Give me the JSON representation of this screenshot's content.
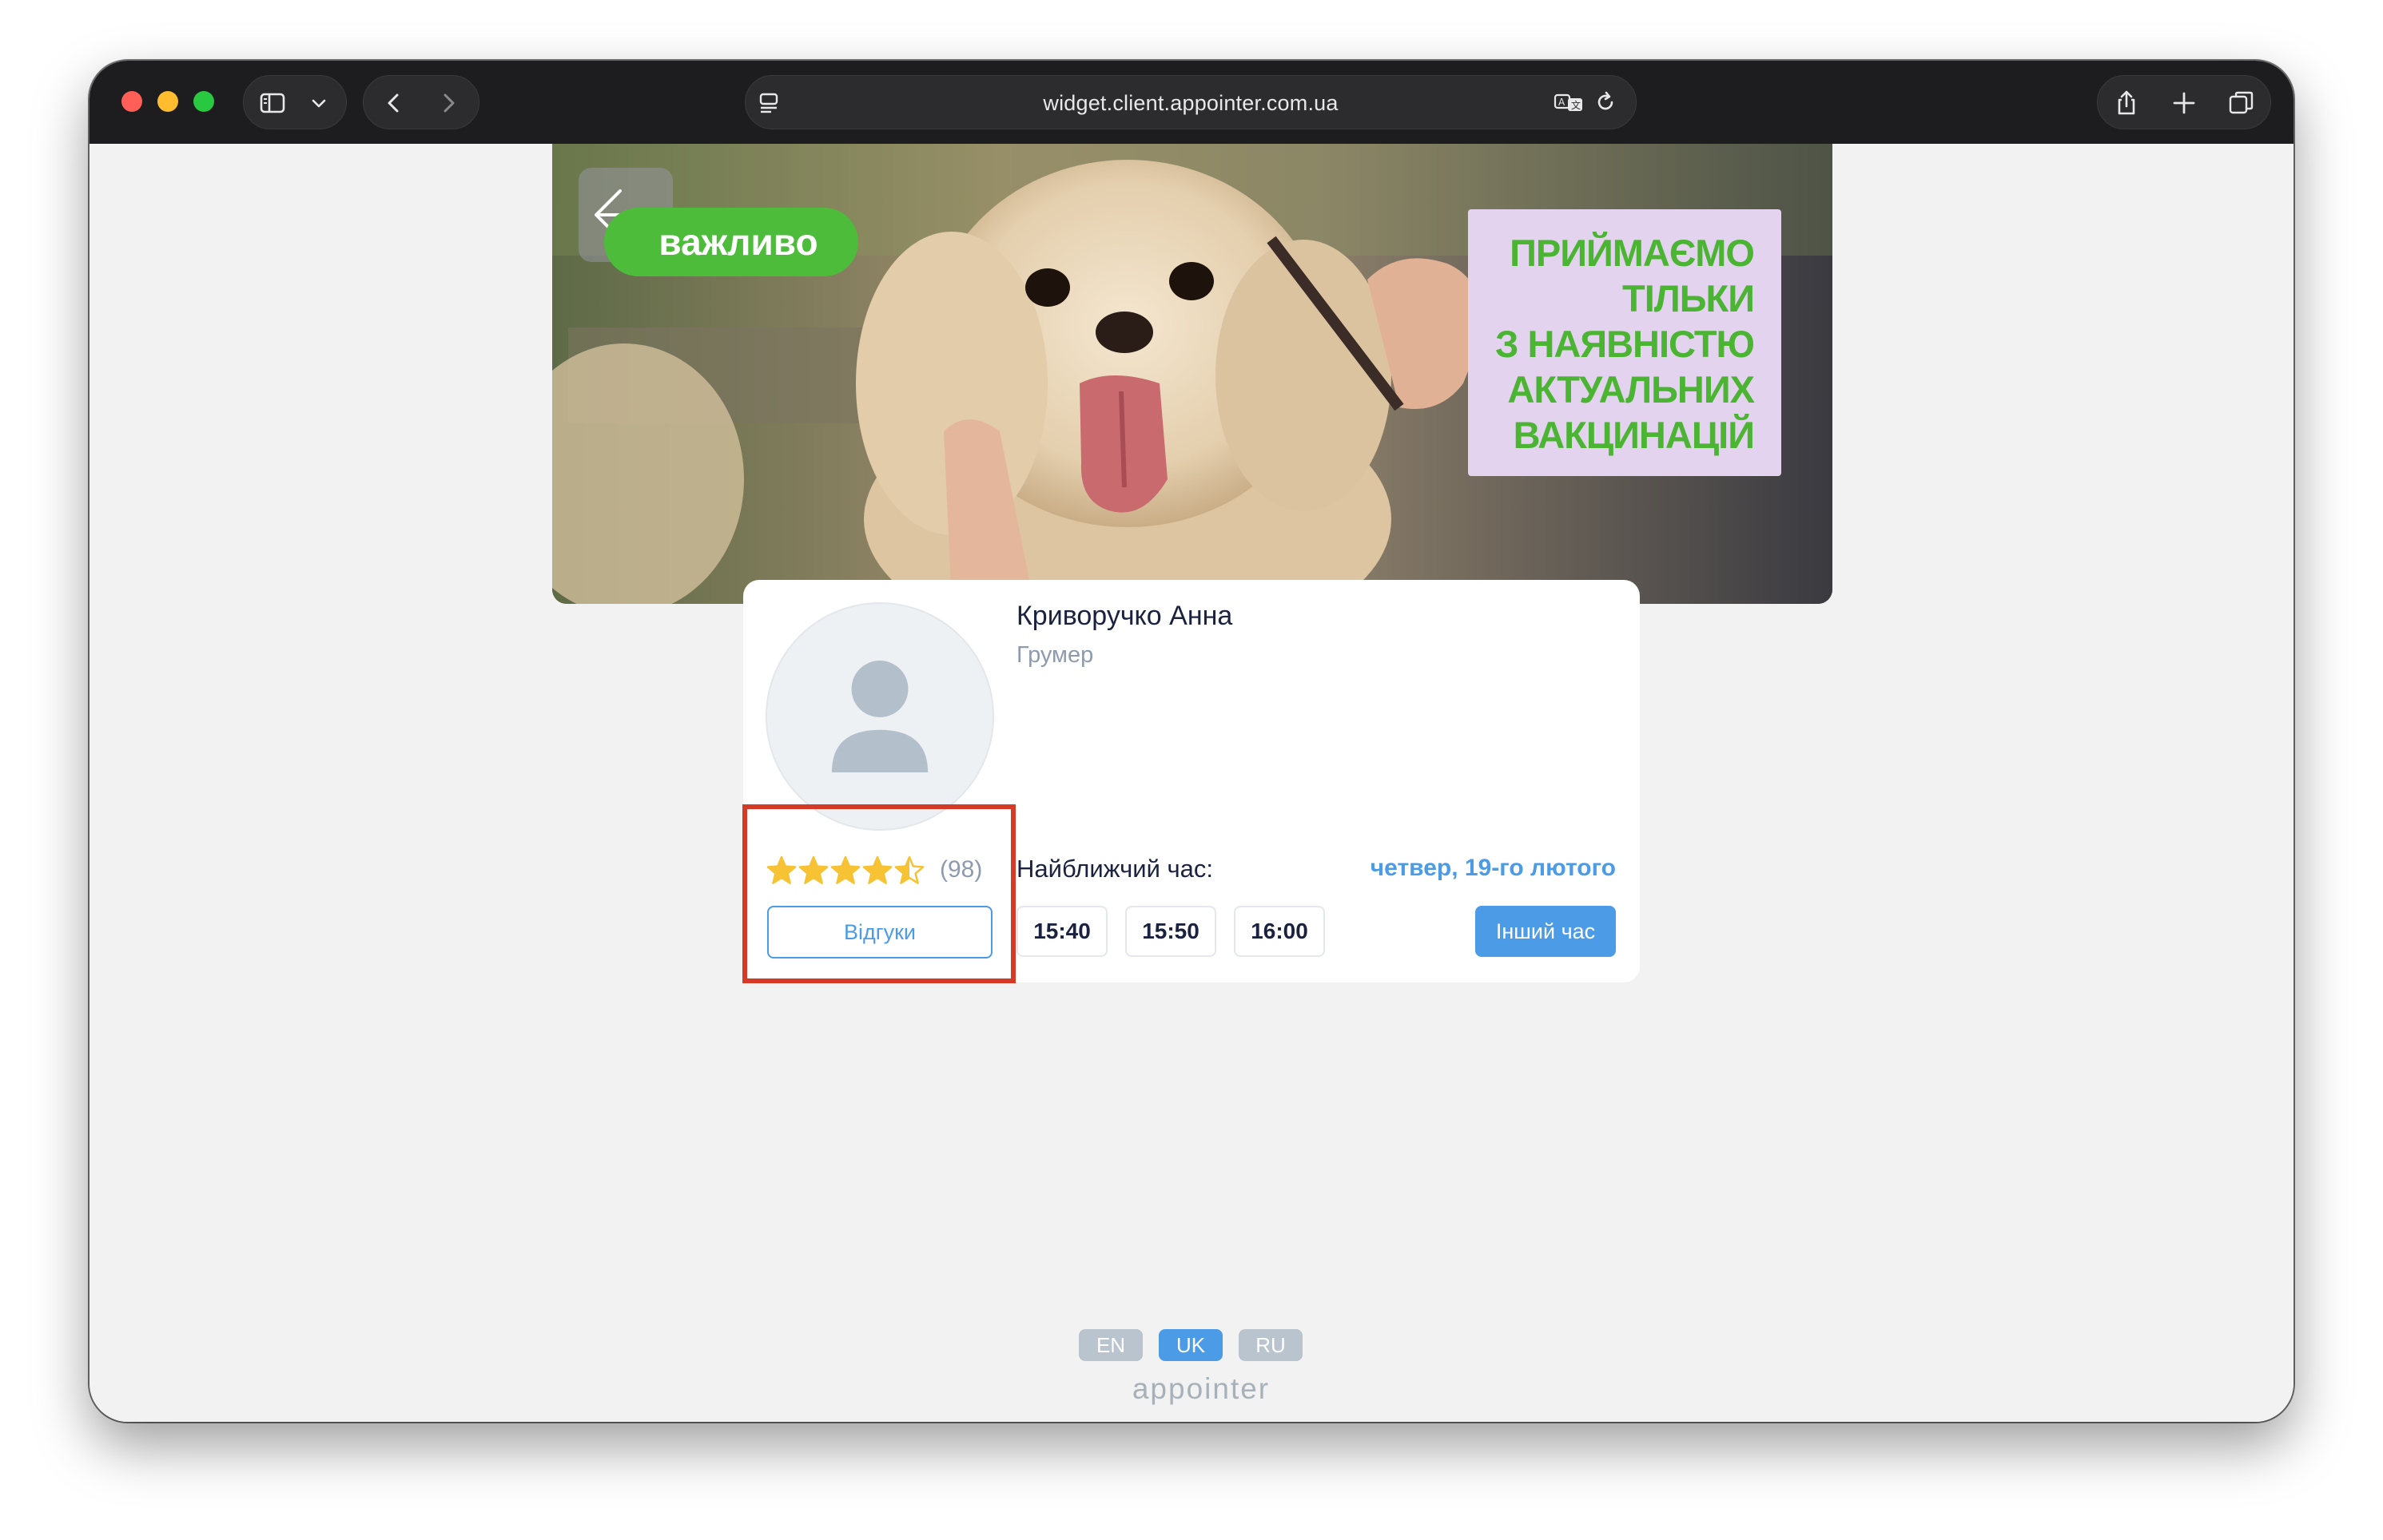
{
  "browser": {
    "url": "widget.client.appointer.com.ua",
    "icons": [
      "sidebar-icon",
      "chevron-down-icon",
      "back-icon",
      "forward-icon",
      "page-menu-icon",
      "translate-icon",
      "reload-icon",
      "share-icon",
      "new-tab-icon",
      "tabs-overview-icon"
    ]
  },
  "banner": {
    "badge_text": "важливо",
    "notice_lines": [
      "ПРИЙМАЄМО",
      "ТІЛЬКИ",
      "З НАЯВНІСТЮ",
      "АКТУАЛЬНИХ",
      "ВАКЦИНАЦІЙ"
    ]
  },
  "employee": {
    "name": "Криворучко Анна",
    "role": "Грумер",
    "rating": 4.5,
    "reviews_count": "(98)",
    "reviews_button": "Відгуки"
  },
  "booking": {
    "nearest_label": "Найближчий час:",
    "nearest_date": "четвер, 19-го лютого",
    "slots": [
      "15:40",
      "15:50",
      "16:00"
    ],
    "other_time_button": "Інший час"
  },
  "footer": {
    "languages": [
      "EN",
      "UK",
      "RU"
    ],
    "active_language": "UK",
    "brand": "appointer"
  },
  "colors": {
    "accent": "#4b9be6",
    "highlight": "#d43a26",
    "star": "#f7c233",
    "banner_green": "#4bb533"
  }
}
